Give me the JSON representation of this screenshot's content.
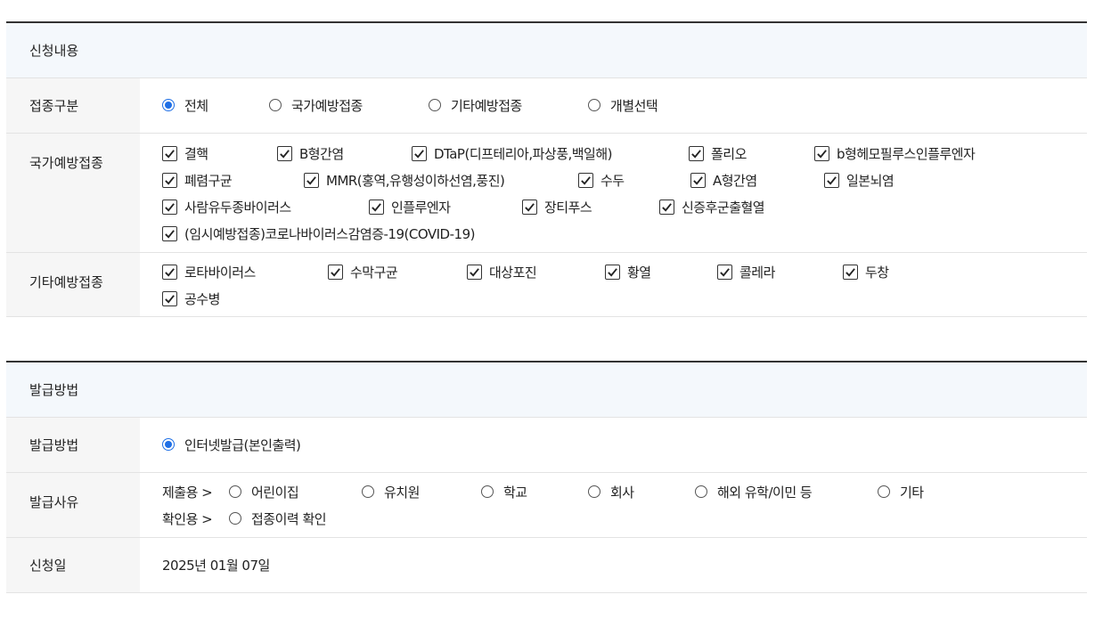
{
  "application": {
    "section_title": "신청내용",
    "vaccination_type": {
      "label": "접종구분",
      "options": [
        "전체",
        "국가예방접종",
        "기타예방접종",
        "개별선택"
      ],
      "selected": "전체"
    },
    "national": {
      "label": "국가예방접종",
      "items": [
        "결핵",
        "B형간염",
        "DTaP(디프테리아,파상풍,백일해)",
        "폴리오",
        "b형헤모필루스인플루엔자",
        "폐렴구균",
        "MMR(홍역,유행성이하선염,풍진)",
        "수두",
        "A형간염",
        "일본뇌염",
        "사람유두종바이러스",
        "인플루엔자",
        "장티푸스",
        "신증후군출혈열",
        "(임시예방접종)코로나바이러스감염증-19(COVID-19)"
      ],
      "checked": true
    },
    "other": {
      "label": "기타예방접종",
      "items": [
        "로타바이러스",
        "수막구균",
        "대상포진",
        "황열",
        "콜레라",
        "두창",
        "공수병"
      ],
      "checked": true
    }
  },
  "issuance": {
    "section_title": "발급방법",
    "method": {
      "label": "발급방법",
      "option": "인터넷발급(본인출력)",
      "selected": true
    },
    "reason": {
      "label": "발급사유",
      "submit_prefix": "제출용 >",
      "submit_options": [
        "어린이집",
        "유치원",
        "학교",
        "회사",
        "해외 유학/이민 등",
        "기타"
      ],
      "confirm_prefix": "확인용 >",
      "confirm_options": [
        "접종이력 확인"
      ]
    },
    "date": {
      "label": "신청일",
      "value": "2025년 01월 07일"
    }
  }
}
